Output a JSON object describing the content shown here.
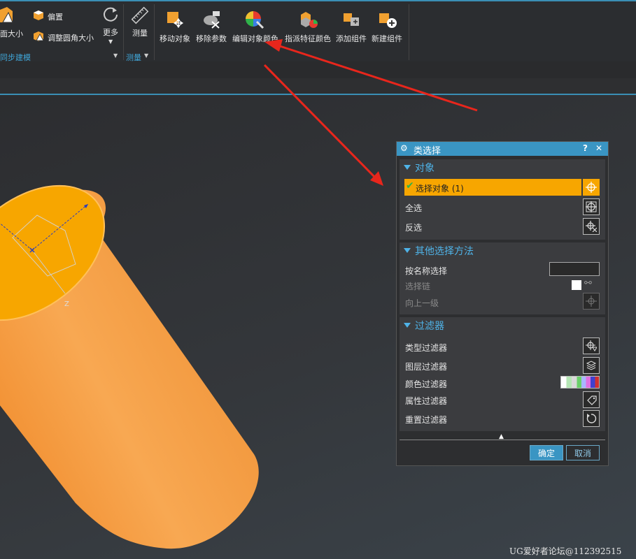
{
  "ribbon": {
    "sync_group": {
      "face_size": "面大小",
      "offset": "偏置",
      "resize_blend": "调整圆角大小",
      "more": "更多",
      "group_label": "同步建模"
    },
    "measure_group": {
      "measure": "测量",
      "group_label": "测量"
    },
    "tools": {
      "move_object": "移动对象",
      "remove_params": "移除参数",
      "edit_object_color": "编辑对象颜色",
      "assign_feature_color": "指派特征颜色",
      "add_component": "添加组件",
      "new_component": "新建组件"
    }
  },
  "dialog": {
    "title": "类选择",
    "help": "?",
    "close": "✕",
    "object_section": {
      "title": "对象",
      "select_object": "选择对象 (1)",
      "select_all": "全选",
      "invert": "反选"
    },
    "other_section": {
      "title": "其他选择方法",
      "by_name": "按名称选择",
      "by_name_value": "",
      "chain": "选择链",
      "up_one_level": "向上一级"
    },
    "filter_section": {
      "title": "过滤器",
      "type_filter": "类型过滤器",
      "layer_filter": "图层过滤器",
      "color_filter": "颜色过滤器",
      "attribute_filter": "属性过滤器",
      "reset_filter": "重置过滤器"
    },
    "ok": "确定",
    "cancel": "取消"
  },
  "axis_label": "Z",
  "watermark": "UG爱好者论坛@112392515",
  "colors": {
    "accent": "#3a95c3",
    "highlight": "#f7a600",
    "cylinder": "#f59a3c",
    "arrow": "#e8261c"
  }
}
